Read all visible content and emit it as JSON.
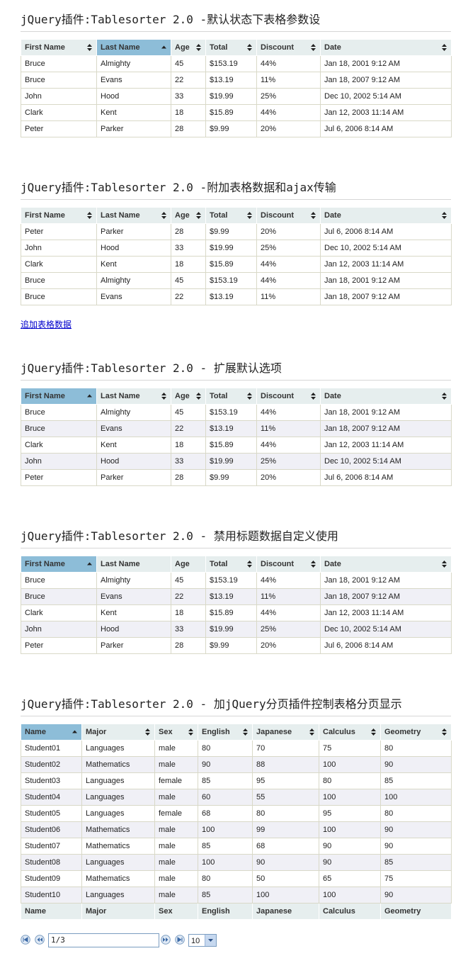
{
  "sections": [
    {
      "title": "jQuery插件:Tablesorter 2.0 -默认状态下表格参数设"
    },
    {
      "title": "jQuery插件:Tablesorter 2.0 -附加表格数据和ajax传输"
    },
    {
      "title": "jQuery插件:Tablesorter 2.0 - 扩展默认选项"
    },
    {
      "title": "jQuery插件:Tablesorter 2.0 - 禁用标题数据自定义使用"
    },
    {
      "title": "jQuery插件:Tablesorter 2.0 - 加jQuery分页插件控制表格分页显示"
    }
  ],
  "people_headers": [
    "First Name",
    "Last Name",
    "Age",
    "Total",
    "Discount",
    "Date"
  ],
  "table1": [
    [
      "Bruce",
      "Almighty",
      "45",
      "$153.19",
      "44%",
      "Jan 18, 2001 9:12 AM"
    ],
    [
      "Bruce",
      "Evans",
      "22",
      "$13.19",
      "11%",
      "Jan 18, 2007 9:12 AM"
    ],
    [
      "John",
      "Hood",
      "33",
      "$19.99",
      "25%",
      "Dec 10, 2002 5:14 AM"
    ],
    [
      "Clark",
      "Kent",
      "18",
      "$15.89",
      "44%",
      "Jan 12, 2003 11:14 AM"
    ],
    [
      "Peter",
      "Parker",
      "28",
      "$9.99",
      "20%",
      "Jul 6, 2006 8:14 AM"
    ]
  ],
  "table2": [
    [
      "Peter",
      "Parker",
      "28",
      "$9.99",
      "20%",
      "Jul 6, 2006 8:14 AM"
    ],
    [
      "John",
      "Hood",
      "33",
      "$19.99",
      "25%",
      "Dec 10, 2002 5:14 AM"
    ],
    [
      "Clark",
      "Kent",
      "18",
      "$15.89",
      "44%",
      "Jan 12, 2003 11:14 AM"
    ],
    [
      "Bruce",
      "Almighty",
      "45",
      "$153.19",
      "44%",
      "Jan 18, 2001 9:12 AM"
    ],
    [
      "Bruce",
      "Evans",
      "22",
      "$13.19",
      "11%",
      "Jan 18, 2007 9:12 AM"
    ]
  ],
  "append_link": "追加表格数据",
  "table3": [
    [
      "Bruce",
      "Almighty",
      "45",
      "$153.19",
      "44%",
      "Jan 18, 2001 9:12 AM"
    ],
    [
      "Bruce",
      "Evans",
      "22",
      "$13.19",
      "11%",
      "Jan 18, 2007 9:12 AM"
    ],
    [
      "Clark",
      "Kent",
      "18",
      "$15.89",
      "44%",
      "Jan 12, 2003 11:14 AM"
    ],
    [
      "John",
      "Hood",
      "33",
      "$19.99",
      "25%",
      "Dec 10, 2002 5:14 AM"
    ],
    [
      "Peter",
      "Parker",
      "28",
      "$9.99",
      "20%",
      "Jul 6, 2006 8:14 AM"
    ]
  ],
  "table4": [
    [
      "Bruce",
      "Almighty",
      "45",
      "$153.19",
      "44%",
      "Jan 18, 2001 9:12 AM"
    ],
    [
      "Bruce",
      "Evans",
      "22",
      "$13.19",
      "11%",
      "Jan 18, 2007 9:12 AM"
    ],
    [
      "Clark",
      "Kent",
      "18",
      "$15.89",
      "44%",
      "Jan 12, 2003 11:14 AM"
    ],
    [
      "John",
      "Hood",
      "33",
      "$19.99",
      "25%",
      "Dec 10, 2002 5:14 AM"
    ],
    [
      "Peter",
      "Parker",
      "28",
      "$9.99",
      "20%",
      "Jul 6, 2006 8:14 AM"
    ]
  ],
  "student_headers": [
    "Name",
    "Major",
    "Sex",
    "English",
    "Japanese",
    "Calculus",
    "Geometry"
  ],
  "table5": [
    [
      "Student01",
      "Languages",
      "male",
      "80",
      "70",
      "75",
      "80"
    ],
    [
      "Student02",
      "Mathematics",
      "male",
      "90",
      "88",
      "100",
      "90"
    ],
    [
      "Student03",
      "Languages",
      "female",
      "85",
      "95",
      "80",
      "85"
    ],
    [
      "Student04",
      "Languages",
      "male",
      "60",
      "55",
      "100",
      "100"
    ],
    [
      "Student05",
      "Languages",
      "female",
      "68",
      "80",
      "95",
      "80"
    ],
    [
      "Student06",
      "Mathematics",
      "male",
      "100",
      "99",
      "100",
      "90"
    ],
    [
      "Student07",
      "Mathematics",
      "male",
      "85",
      "68",
      "90",
      "90"
    ],
    [
      "Student08",
      "Languages",
      "male",
      "100",
      "90",
      "90",
      "85"
    ],
    [
      "Student09",
      "Mathematics",
      "male",
      "80",
      "50",
      "65",
      "75"
    ],
    [
      "Student10",
      "Languages",
      "male",
      "85",
      "100",
      "100",
      "90"
    ]
  ],
  "pager": {
    "display": "1/3",
    "page_size": "10"
  },
  "colors": {
    "header_bg": "#e6eeee",
    "sorted_header_bg": "#8dbdd8",
    "odd_row_bg": "#f0f0f6",
    "link": "#0000cc"
  }
}
